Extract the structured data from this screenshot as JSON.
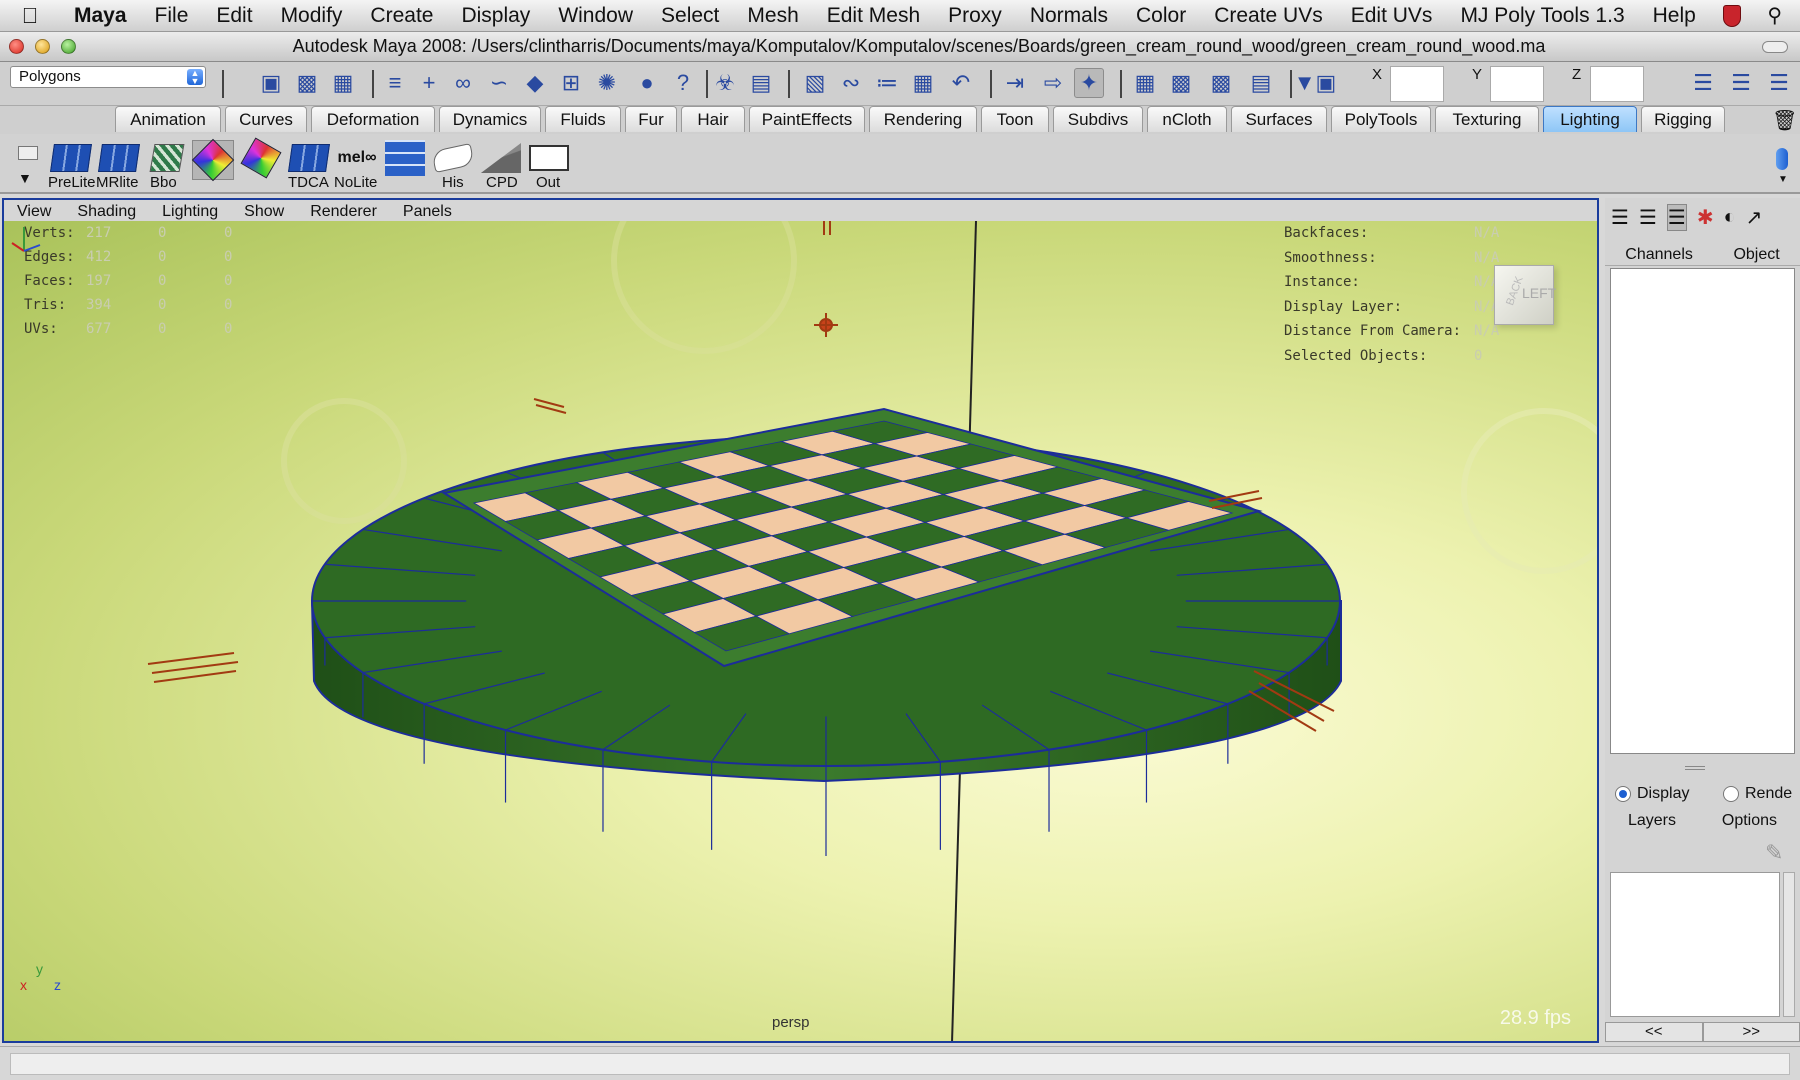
{
  "menubar": {
    "app": "Maya",
    "items": [
      "File",
      "Edit",
      "Modify",
      "Create",
      "Display",
      "Window",
      "Select",
      "Mesh",
      "Edit Mesh",
      "Proxy",
      "Normals",
      "Color",
      "Create UVs",
      "Edit UVs",
      "MJ Poly Tools 1.3",
      "Help"
    ]
  },
  "window": {
    "title": "Autodesk Maya 2008: /Users/clintharris/Documents/maya/Komputalov/Komputalov/scenes/Boards/green_cream_round_wood/green_cream_round_wood.ma"
  },
  "statusline": {
    "mode": "Polygons",
    "x_label": "X",
    "y_label": "Y",
    "z_label": "Z",
    "x_value": "",
    "y_value": "",
    "z_value": ""
  },
  "shelf_tabs": [
    "Animation",
    "Curves",
    "Deformation",
    "Dynamics",
    "Fluids",
    "Fur",
    "Hair",
    "PaintEffects",
    "Rendering",
    "Toon",
    "Subdivs",
    "nCloth",
    "Surfaces",
    "PolyTools",
    "Texturing",
    "Lighting",
    "Rigging"
  ],
  "active_shelf_tab": "Lighting",
  "shelf_items": [
    "PreLite",
    "MRlite",
    "Bbo",
    "",
    "",
    "TDCA",
    "NoLite",
    "",
    "His",
    "CPD",
    "Out"
  ],
  "viewport": {
    "menus": [
      "View",
      "Shading",
      "Lighting",
      "Show",
      "Renderer",
      "Panels"
    ],
    "hud_left": [
      {
        "label": "Verts:",
        "v1": "217",
        "v2": "0",
        "v3": "0"
      },
      {
        "label": "Edges:",
        "v1": "412",
        "v2": "0",
        "v3": "0"
      },
      {
        "label": "Faces:",
        "v1": "197",
        "v2": "0",
        "v3": "0"
      },
      {
        "label": "Tris:",
        "v1": "394",
        "v2": "0",
        "v3": "0"
      },
      {
        "label": "UVs:",
        "v1": "677",
        "v2": "0",
        "v3": "0"
      }
    ],
    "hud_right": [
      {
        "label": "Backfaces:",
        "value": "N/A"
      },
      {
        "label": "Smoothness:",
        "value": "N/A"
      },
      {
        "label": "Instance:",
        "value": "N/A"
      },
      {
        "label": "Display Layer:",
        "value": "N/A"
      },
      {
        "label": "Distance From Camera:",
        "value": "N/A"
      },
      {
        "label": "Selected Objects:",
        "value": "0"
      }
    ],
    "camera": "persp",
    "fps": "28.9 fps",
    "viewcube": {
      "back": "BACK",
      "left": "LEFT"
    },
    "axis": {
      "x": "x",
      "y": "y",
      "z": "z"
    },
    "colors": {
      "board": "#2e6a23",
      "light_square": "#f2c9a3",
      "dark_square": "#2f6b24",
      "wire": "#1c2c9a"
    }
  },
  "right_panel": {
    "tabs": [
      "Channels",
      "Object"
    ],
    "radios": [
      {
        "label": "Display",
        "selected": true
      },
      {
        "label": "Rende",
        "selected": false
      }
    ],
    "layer_menu": [
      "Layers",
      "Options"
    ],
    "nav": [
      "<<",
      ">>"
    ]
  }
}
